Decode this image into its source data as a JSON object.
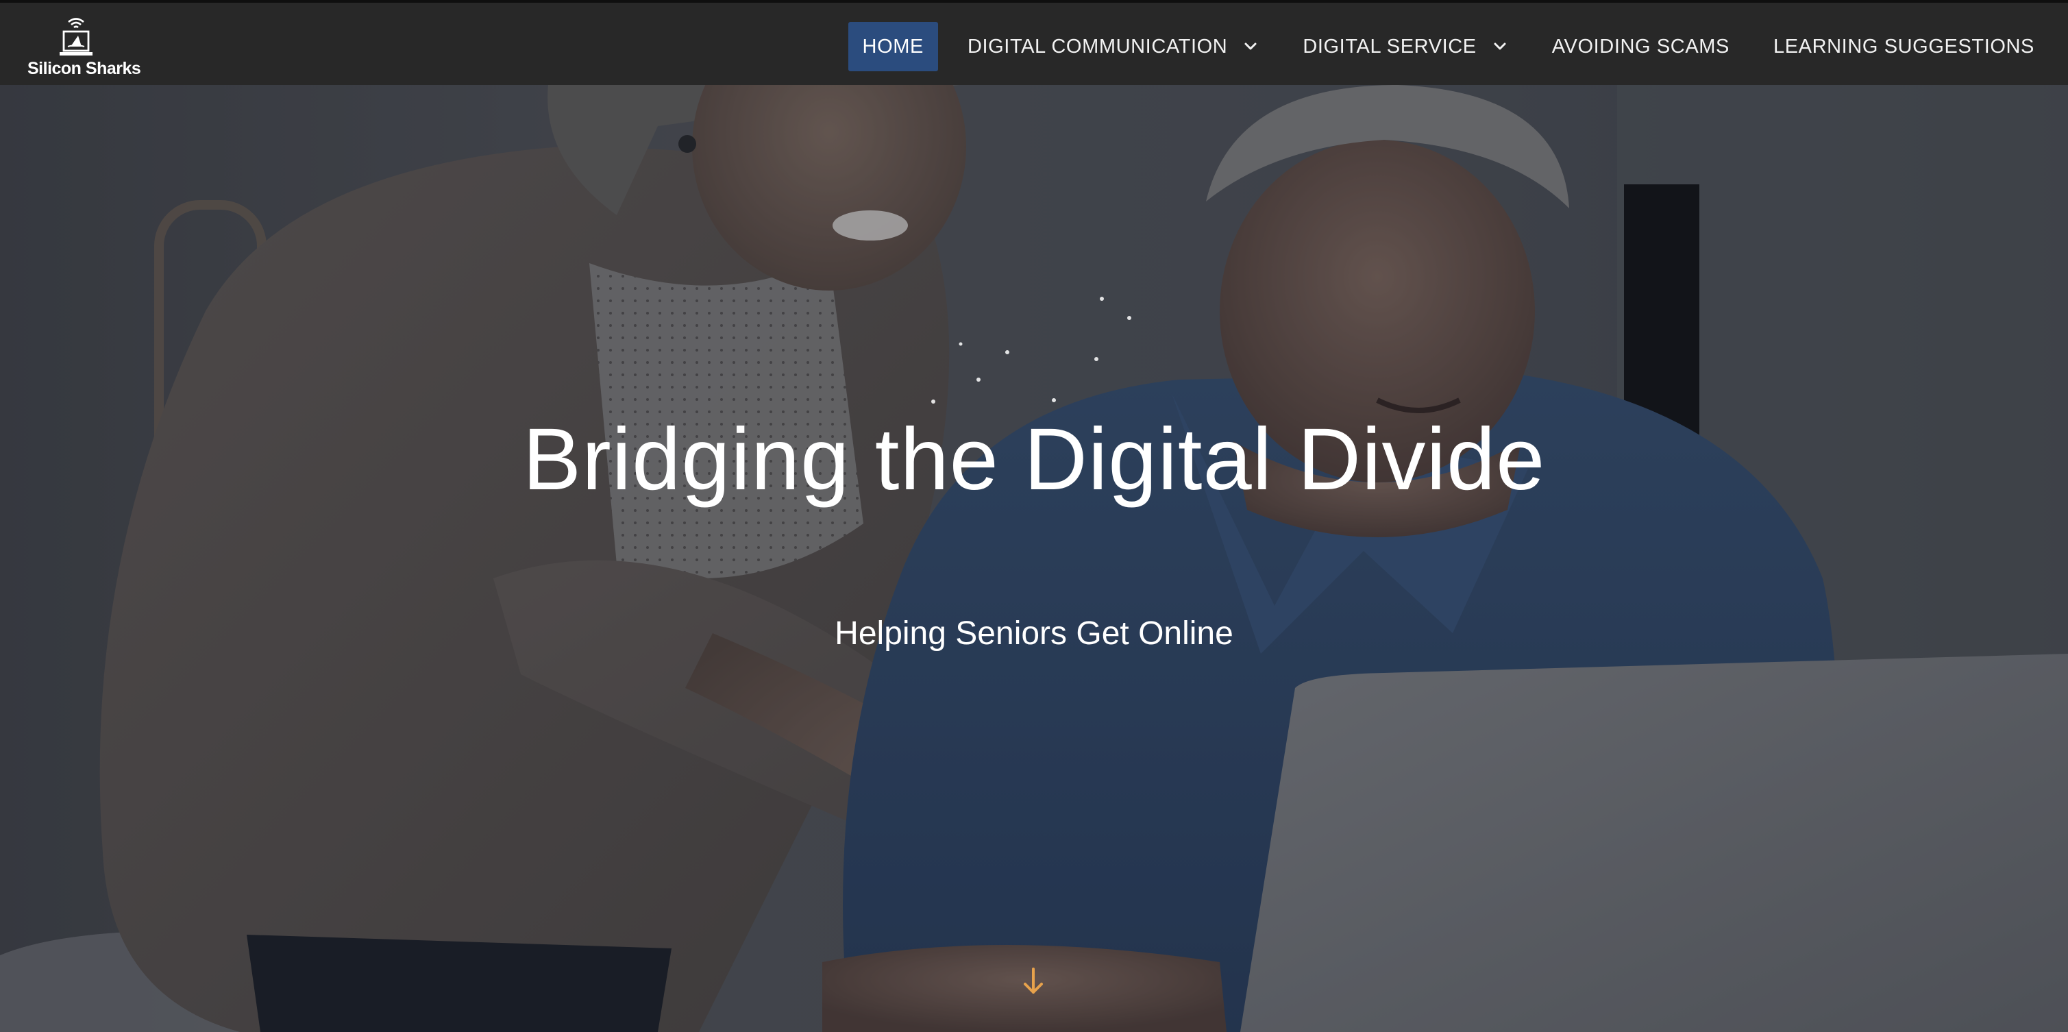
{
  "brand": {
    "name": "Silicon Sharks",
    "logo_icon": "laptop-wifi-icon"
  },
  "nav": {
    "items": [
      {
        "label": "HOME",
        "active": true,
        "has_dropdown": false
      },
      {
        "label": "DIGITAL COMMUNICATION",
        "active": false,
        "has_dropdown": true
      },
      {
        "label": "DIGITAL SERVICE",
        "active": false,
        "has_dropdown": true
      },
      {
        "label": "AVOIDING SCAMS",
        "active": false,
        "has_dropdown": false
      },
      {
        "label": "LEARNING SUGGESTIONS",
        "active": false,
        "has_dropdown": false
      }
    ]
  },
  "hero": {
    "title": "Bridging the Digital Divide",
    "subtitle": "Helping Seniors Get Online",
    "scroll_icon": "arrow-down-icon"
  },
  "colors": {
    "nav_background": "#282828",
    "active_nav": "#2b4c7e",
    "scroll_arrow": "#e7a24c",
    "text": "#ffffff"
  }
}
